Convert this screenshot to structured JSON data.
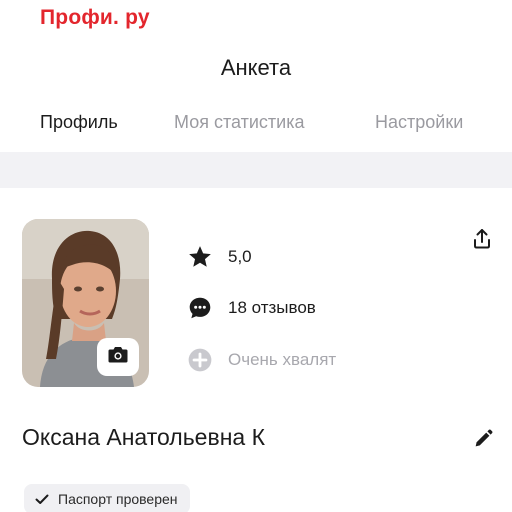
{
  "brand": {
    "name": "Профи. ру"
  },
  "header": {
    "title": "Анкета"
  },
  "tabs": [
    {
      "label": "Профиль",
      "active": true
    },
    {
      "label": "Моя статистика",
      "active": false
    },
    {
      "label": "Настройки",
      "active": false
    }
  ],
  "profile": {
    "rating": "5,0",
    "reviews": "18 отзывов",
    "praise": "Очень хвалят",
    "name": "Оксана Анатольевна К",
    "verified_badge": "Паспорт проверен"
  },
  "icons": {
    "rating": "star-icon",
    "reviews": "chat-bubble-icon",
    "praise": "plus-circle-icon",
    "share": "upload-icon",
    "edit": "pencil-icon",
    "camera": "camera-icon",
    "verified": "check-icon"
  },
  "colors": {
    "brand": "#e3262d",
    "text": "#1c1c1c",
    "muted": "#9a9aa0",
    "divider": "#f2f2f5",
    "badge_bg": "#f0f0f3"
  }
}
